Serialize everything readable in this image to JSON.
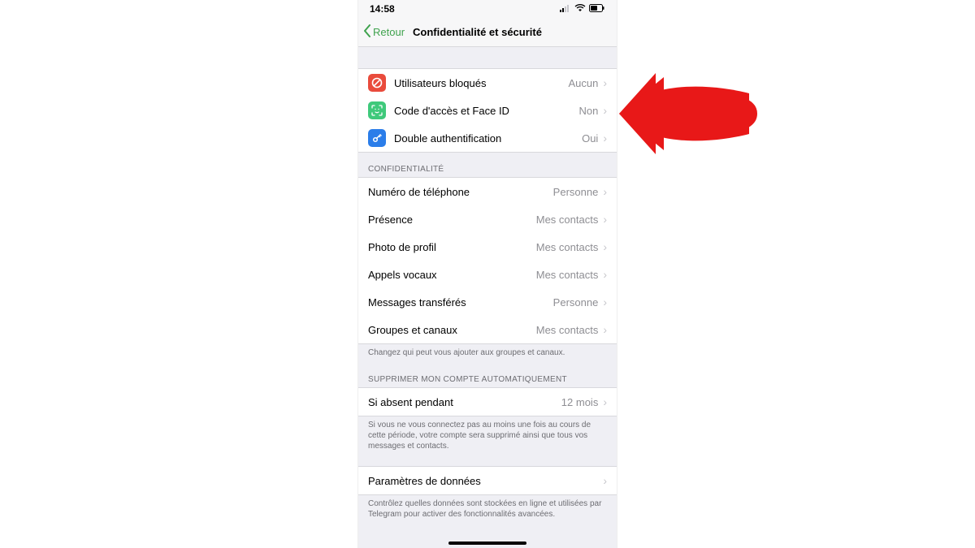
{
  "status": {
    "time": "14:58"
  },
  "nav": {
    "back": "Retour",
    "title": "Confidentialité et sécurité"
  },
  "section1": {
    "items": [
      {
        "label": "Utilisateurs bloqués",
        "value": "Aucun",
        "icon_bg": "#e94b3c",
        "icon": "block"
      },
      {
        "label": "Code d'accès et Face ID",
        "value": "Non",
        "icon_bg": "#3fc97b",
        "icon": "face"
      },
      {
        "label": "Double authentification",
        "value": "Oui",
        "icon_bg": "#2b7de9",
        "icon": "key"
      }
    ]
  },
  "privacy": {
    "header": "CONFIDENTIALITÉ",
    "items": [
      {
        "label": "Numéro de téléphone",
        "value": "Personne"
      },
      {
        "label": "Présence",
        "value": "Mes contacts"
      },
      {
        "label": "Photo de profil",
        "value": "Mes contacts"
      },
      {
        "label": "Appels vocaux",
        "value": "Mes contacts"
      },
      {
        "label": "Messages transférés",
        "value": "Personne"
      },
      {
        "label": "Groupes et canaux",
        "value": "Mes contacts"
      }
    ],
    "footer": "Changez qui peut vous ajouter aux groupes et canaux."
  },
  "autodelete": {
    "header": "SUPPRIMER MON COMPTE AUTOMATIQUEMENT",
    "item": {
      "label": "Si absent pendant",
      "value": "12 mois"
    },
    "footer": "Si vous ne vous connectez pas au moins une fois au cours de cette période, votre compte sera supprimé ainsi que tous vos messages et contacts."
  },
  "data": {
    "item": {
      "label": "Paramètres de données",
      "value": ""
    },
    "footer": "Contrôlez quelles données sont stockées en ligne et utilisées par Telegram pour activer des fonctionnalités avancées."
  }
}
